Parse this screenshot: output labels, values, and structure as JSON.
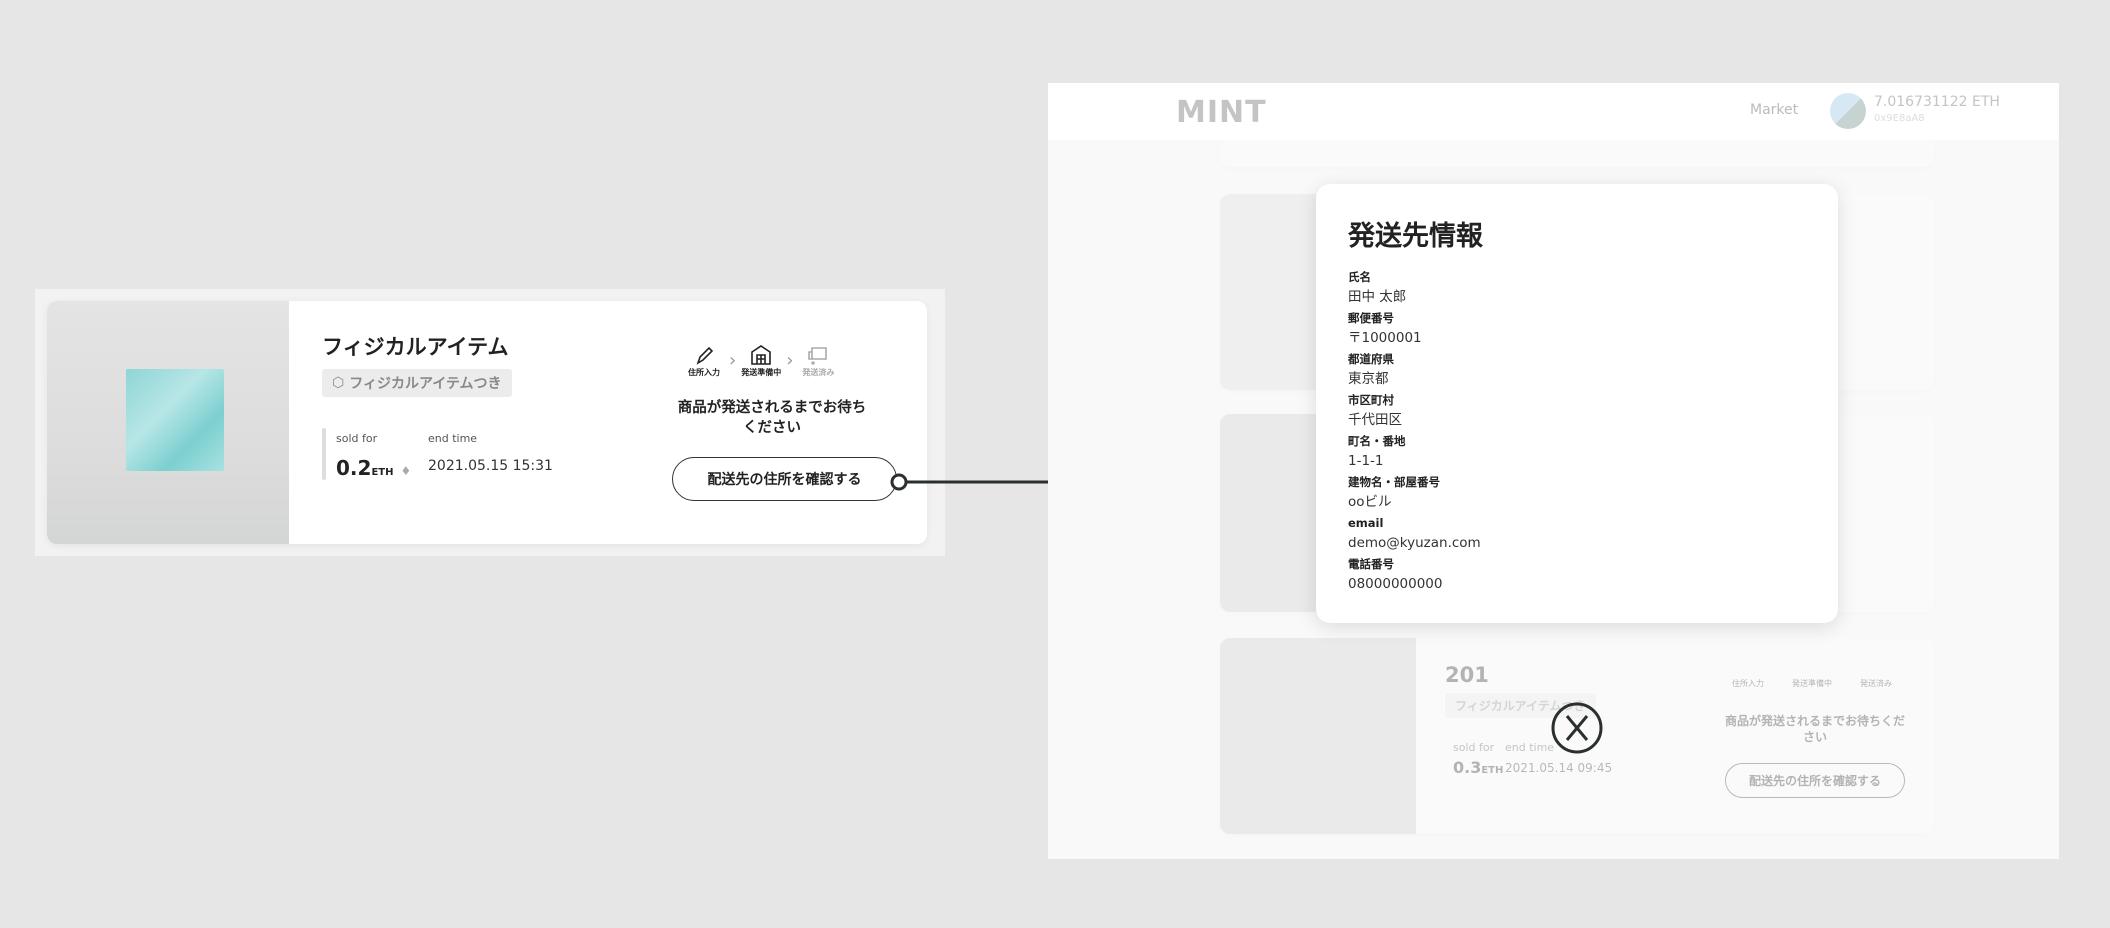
{
  "left_card": {
    "title": "フィジカルアイテム",
    "tag": "フィジカルアイテムつき",
    "sold_for_label": "sold for",
    "price": "0.2",
    "currency": "ETH",
    "end_time_label": "end time",
    "end_time": "2021.05.15 15:31",
    "steps": [
      "住所入力",
      "発送準備中",
      "発送済み"
    ],
    "active_step": 2,
    "message": "商品が発送されるまでお待ちください",
    "button": "配送先の住所を確認する"
  },
  "app": {
    "logo": "MINT",
    "nav_market": "Market",
    "balance": "7.016731122 ETH",
    "address": "0x9E8aA8"
  },
  "modal": {
    "title": "発送先情報",
    "fields": [
      {
        "label": "氏名",
        "value": "田中 太郎"
      },
      {
        "label": "郵便番号",
        "value": "〒1000001"
      },
      {
        "label": "都道府県",
        "value": "東京都"
      },
      {
        "label": "市区町村",
        "value": "千代田区"
      },
      {
        "label": "町名・番地",
        "value": "1-1-1"
      },
      {
        "label": "建物名・部屋番号",
        "value": "ooビル"
      },
      {
        "label": "email",
        "value": "demo@kyuzan.com"
      },
      {
        "label": "電話番号",
        "value": "08000000000"
      }
    ]
  },
  "bg_card": {
    "title": "201",
    "tag": "フィジカルアイテムつき",
    "sold_for_label": "sold for",
    "price": "0.3",
    "currency": "ETH",
    "end_time_label": "end time",
    "end_time": "2021.05.14 09:45",
    "steps": [
      "住所入力",
      "発送準備中",
      "発送済み"
    ],
    "message": "商品が発送されるまでお待ちください",
    "button": "配送先の住所を確認する"
  },
  "colors": {
    "background": "#e6e6e6",
    "text": "#222222",
    "arrow": "#2a2f30"
  }
}
